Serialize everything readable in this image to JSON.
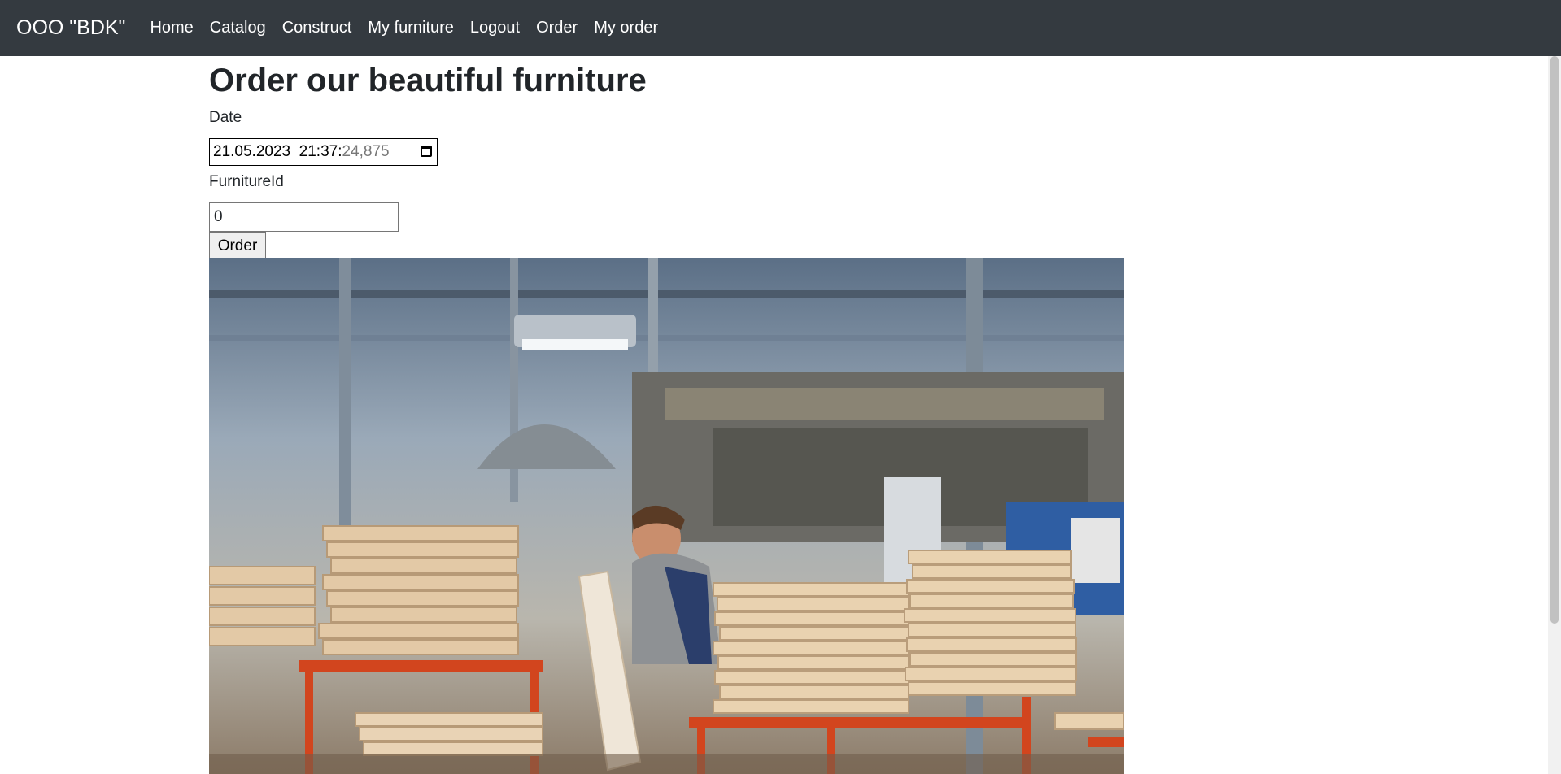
{
  "navbar": {
    "brand": "OOO \"BDK\"",
    "links": [
      "Home",
      "Catalog",
      "Construct",
      "My furniture",
      "Logout",
      "Order",
      "My order"
    ]
  },
  "main": {
    "title": "Order our beautiful furniture",
    "date_label": "Date",
    "date_value_main": "21.05.2023  21:37:",
    "date_value_dim": "24,875",
    "furniture_label": "FurnitureId",
    "furniture_value": "0",
    "order_button": "Order"
  },
  "colors": {
    "navbar_bg": "#343a40",
    "navbar_text": "#ffffff",
    "table_orange": "#d2451e"
  },
  "image": {
    "icon": "furniture-factory-photo"
  }
}
